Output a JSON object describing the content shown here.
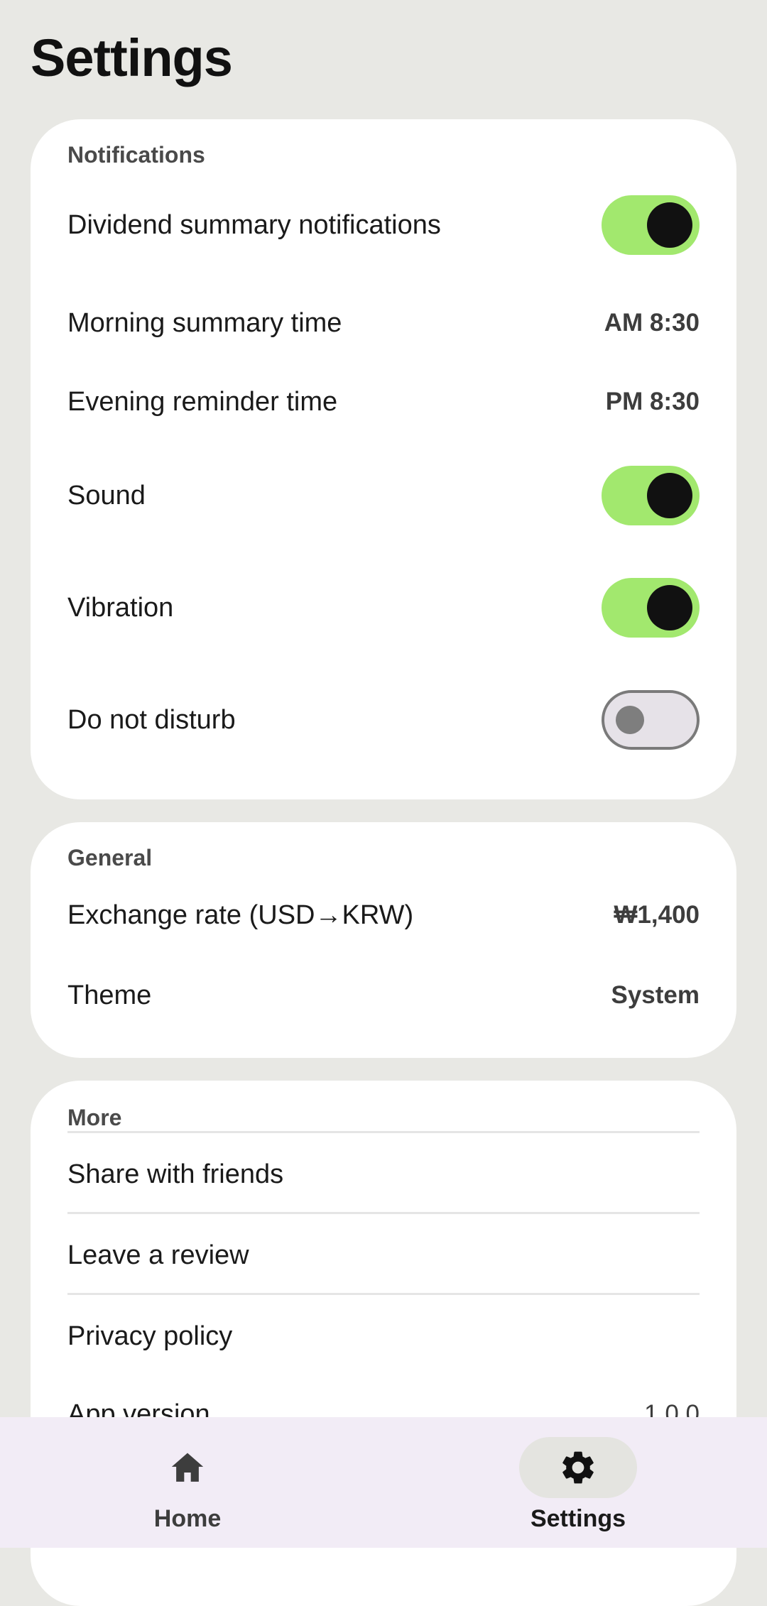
{
  "page_title": "Settings",
  "notifications": {
    "label": "Notifications",
    "dividend_summary": {
      "label": "Dividend summary notifications",
      "enabled": true
    },
    "morning_time": {
      "label": "Morning summary time",
      "value": "AM 8:30"
    },
    "evening_time": {
      "label": "Evening reminder time",
      "value": "PM 8:30"
    },
    "sound": {
      "label": "Sound",
      "enabled": true
    },
    "vibration": {
      "label": "Vibration",
      "enabled": true
    },
    "do_not_disturb": {
      "label": "Do not disturb",
      "enabled": false
    }
  },
  "general": {
    "label": "General",
    "exchange_rate": {
      "label": "Exchange rate (USD→KRW)",
      "value": "₩1,400"
    },
    "theme": {
      "label": "Theme",
      "value": "System"
    }
  },
  "more": {
    "label": "More",
    "share": {
      "label": "Share with friends"
    },
    "review": {
      "label": "Leave a review"
    },
    "privacy": {
      "label": "Privacy policy"
    },
    "app_version": {
      "label": "App version",
      "value": "1.0.0"
    }
  },
  "bottom_nav": {
    "home": {
      "label": "Home",
      "icon": "home-icon"
    },
    "settings": {
      "label": "Settings",
      "icon": "gear-icon",
      "selected": true
    }
  },
  "colors": {
    "background": "#e8e8e4",
    "card": "#ffffff",
    "toggle_on": "#a2e86e",
    "toggle_knob": "#111111",
    "nav_background": "#f2ecf6"
  }
}
